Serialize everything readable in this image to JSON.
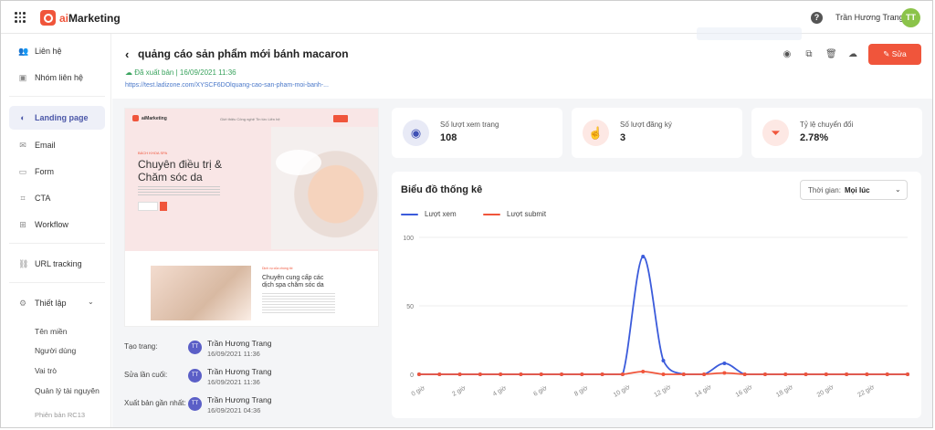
{
  "app": {
    "logo_prefix": "ai",
    "logo_name": "Marketing",
    "user_name": "Trần Hương Trang",
    "avatar_initials": "TT",
    "help": "?"
  },
  "sidebar": {
    "items": [
      {
        "label": "Liên hệ",
        "icon": "contacts-icon"
      },
      {
        "label": "Nhóm liên hệ",
        "icon": "contact-group-icon"
      },
      {
        "label": "Landing page",
        "icon": "landing-page-icon",
        "active": true
      },
      {
        "label": "Email",
        "icon": "email-icon"
      },
      {
        "label": "Form",
        "icon": "form-icon"
      },
      {
        "label": "CTA",
        "icon": "cta-icon"
      },
      {
        "label": "Workflow",
        "icon": "workflow-icon"
      },
      {
        "label": "URL tracking",
        "icon": "link-icon"
      },
      {
        "label": "Thiết lập",
        "icon": "gear-icon"
      }
    ],
    "settings_sub": [
      "Tên miền",
      "Người dùng",
      "Vai trò",
      "Quản lý tài nguyên"
    ],
    "version": "Phiên bản RC13"
  },
  "page": {
    "title": "quảng cáo sản phẩm mới bánh macaron",
    "status": "Đã xuất bản | 16/09/2021 11:36",
    "url": "https://test.ladizone.com/XYSCF6DOlquang-cao-san-pham-moi-banh-...",
    "edit_label": "Sửa"
  },
  "preview": {
    "brand": "aiMarketing",
    "menu": "Giới thiệu    Công nghệ    Tin tức    Liên hệ",
    "hero_small": "BÁCH KHOA SPA",
    "hero_title_1": "Chuyên điều trị &",
    "hero_title_2": "Chăm sóc da",
    "section_small": "Dịch vụ của chúng tôi",
    "section_title_1": "Chuyên cung cấp các",
    "section_title_2": "dịch spa chăm sóc da"
  },
  "meta": [
    {
      "label": "Tạo trang:",
      "initials": "TT",
      "name": "Trần Hương Trang",
      "date": "16/09/2021 11:36"
    },
    {
      "label": "Sửa lần cuối:",
      "initials": "TT",
      "name": "Trần Hương Trang",
      "date": "16/09/2021 11:36"
    },
    {
      "label": "Xuất bản gần nhất:",
      "initials": "TT",
      "name": "Trần Hương Trang",
      "date": "16/09/2021 04:36"
    }
  ],
  "stats": [
    {
      "label": "Số lượt xem trang",
      "value": "108",
      "icon": "eye-icon",
      "color": "#3f51b5",
      "bg": "#e8eaf6"
    },
    {
      "label": "Số lượt đăng ký",
      "value": "3",
      "icon": "hand-pointer-icon",
      "color": "#f0553b",
      "bg": "#fde8e4"
    },
    {
      "label": "Tỷ lệ chuyển đổi",
      "value": "2.78%",
      "icon": "funnel-icon",
      "color": "#f0553b",
      "bg": "#fde8e4"
    }
  ],
  "chart": {
    "title": "Biểu đồ thống kê",
    "filter_label": "Thời gian:",
    "filter_value": "Mọi lúc"
  },
  "chart_data": {
    "type": "line",
    "x": [
      "0 giờ",
      "1 giờ",
      "2 giờ",
      "3 giờ",
      "4 giờ",
      "5 giờ",
      "6 giờ",
      "7 giờ",
      "8 giờ",
      "9 giờ",
      "10 giờ",
      "11 giờ",
      "12 giờ",
      "13 giờ",
      "14 giờ",
      "15 giờ",
      "16 giờ",
      "17 giờ",
      "18 giờ",
      "19 giờ",
      "20 giờ",
      "21 giờ",
      "22 giờ",
      "23 giờ"
    ],
    "x_tick_labels": [
      "0 giờ",
      "2 giờ",
      "4 giờ",
      "6 giờ",
      "8 giờ",
      "10 giờ",
      "12 giờ",
      "14 giờ",
      "16 giờ",
      "18 giờ",
      "20 giờ",
      "22 giờ"
    ],
    "ylim": [
      0,
      100
    ],
    "y_ticks": [
      0,
      50,
      100
    ],
    "grid": true,
    "legend": "top-left",
    "series": [
      {
        "name": "Lượt xem",
        "color": "#3b5bdb",
        "values": [
          0,
          0,
          0,
          0,
          0,
          0,
          0,
          0,
          0,
          0,
          0,
          86,
          10,
          0,
          0,
          8,
          0,
          0,
          0,
          0,
          0,
          0,
          0,
          0,
          0
        ]
      },
      {
        "name": "Lượt submit",
        "color": "#f0553b",
        "values": [
          0,
          0,
          0,
          0,
          0,
          0,
          0,
          0,
          0,
          0,
          0,
          2,
          0,
          0,
          0,
          1,
          0,
          0,
          0,
          0,
          0,
          0,
          0,
          0,
          0
        ]
      }
    ]
  }
}
